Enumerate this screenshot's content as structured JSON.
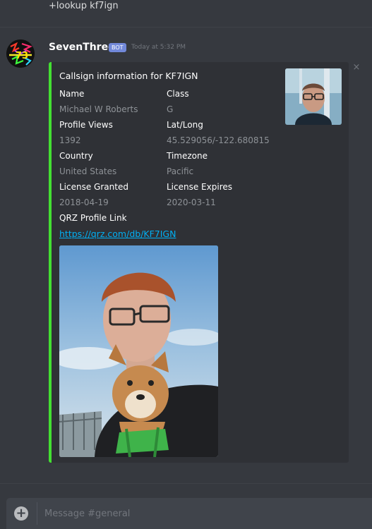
{
  "previous_message": {
    "text": "+lookup kf7ign"
  },
  "message": {
    "author": "SevenThree",
    "bot_tag": "BOT",
    "timestamp": "Today at 5:32 PM"
  },
  "embed": {
    "title": "Callsign information for KF7IGN",
    "accent_color": "#43e032",
    "close_icon": "×",
    "fields": {
      "name": {
        "label": "Name",
        "value": "Michael W Roberts"
      },
      "class": {
        "label": "Class",
        "value": "G"
      },
      "profile_views": {
        "label": "Profile Views",
        "value": "1392"
      },
      "lat_long": {
        "label": "Lat/Long",
        "value": "45.529056/-122.680815"
      },
      "country": {
        "label": "Country",
        "value": "United States"
      },
      "timezone": {
        "label": "Timezone",
        "value": "Pacific"
      },
      "license_granted": {
        "label": "License Granted",
        "value": "2018-04-19"
      },
      "license_expires": {
        "label": "License Expires",
        "value": "2020-03-11"
      },
      "qrz_profile": {
        "label": "QRZ Profile Link",
        "value": "https://qrz.com/db/KF7IGN"
      }
    }
  },
  "composer": {
    "placeholder": "Message #general",
    "add_icon": "+"
  },
  "colors": {
    "background": "#36393f",
    "embed_background": "#2f3136",
    "accent": "#43e032",
    "link": "#00b0f4",
    "bot_tag": "#7289da"
  }
}
